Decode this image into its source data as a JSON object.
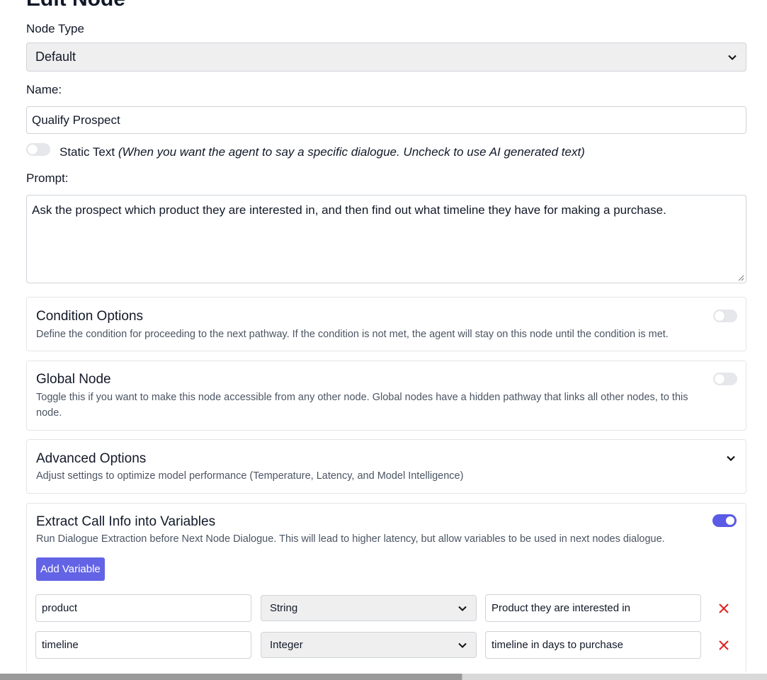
{
  "page": {
    "title": "Edit Node"
  },
  "node_type": {
    "label": "Node Type",
    "value": "Default"
  },
  "name": {
    "label": "Name:",
    "value": "Qualify Prospect"
  },
  "static_text": {
    "label": "Static Text",
    "hint": "(When you want the agent to say a specific dialogue. Uncheck to use AI generated text)",
    "enabled": false
  },
  "prompt": {
    "label": "Prompt:",
    "value": "Ask the prospect which product they are interested in,  and then find out what timeline they have for making a purchase."
  },
  "condition_options": {
    "title": "Condition Options",
    "description": "Define the condition for proceeding to the next pathway. If the condition is not met, the agent will stay on this node until the condition is met.",
    "enabled": false
  },
  "global_node": {
    "title": "Global Node",
    "description": "Toggle this if you want to make this node accessible from any other node. Global nodes have a hidden pathway that links all other nodes, to this node.",
    "enabled": false
  },
  "advanced_options": {
    "title": "Advanced Options",
    "description": "Adjust settings to optimize model performance (Temperature, Latency, and Model Intelligence)",
    "expanded": false
  },
  "extract_vars": {
    "title": "Extract Call Info into Variables",
    "description": "Run Dialogue Extraction before Next Node Dialogue. This will lead to higher latency, but allow variables to be used in next nodes dialogue.",
    "enabled": true,
    "add_button": "Add Variable",
    "variables": [
      {
        "name": "product",
        "type": "String",
        "description": "Product they are interested in"
      },
      {
        "name": "timeline",
        "type": "Integer",
        "description": "timeline in days to purchase"
      }
    ]
  },
  "colors": {
    "accent": "#6363e6",
    "delete": "#e11d1d",
    "select_bg": "#efefef"
  }
}
